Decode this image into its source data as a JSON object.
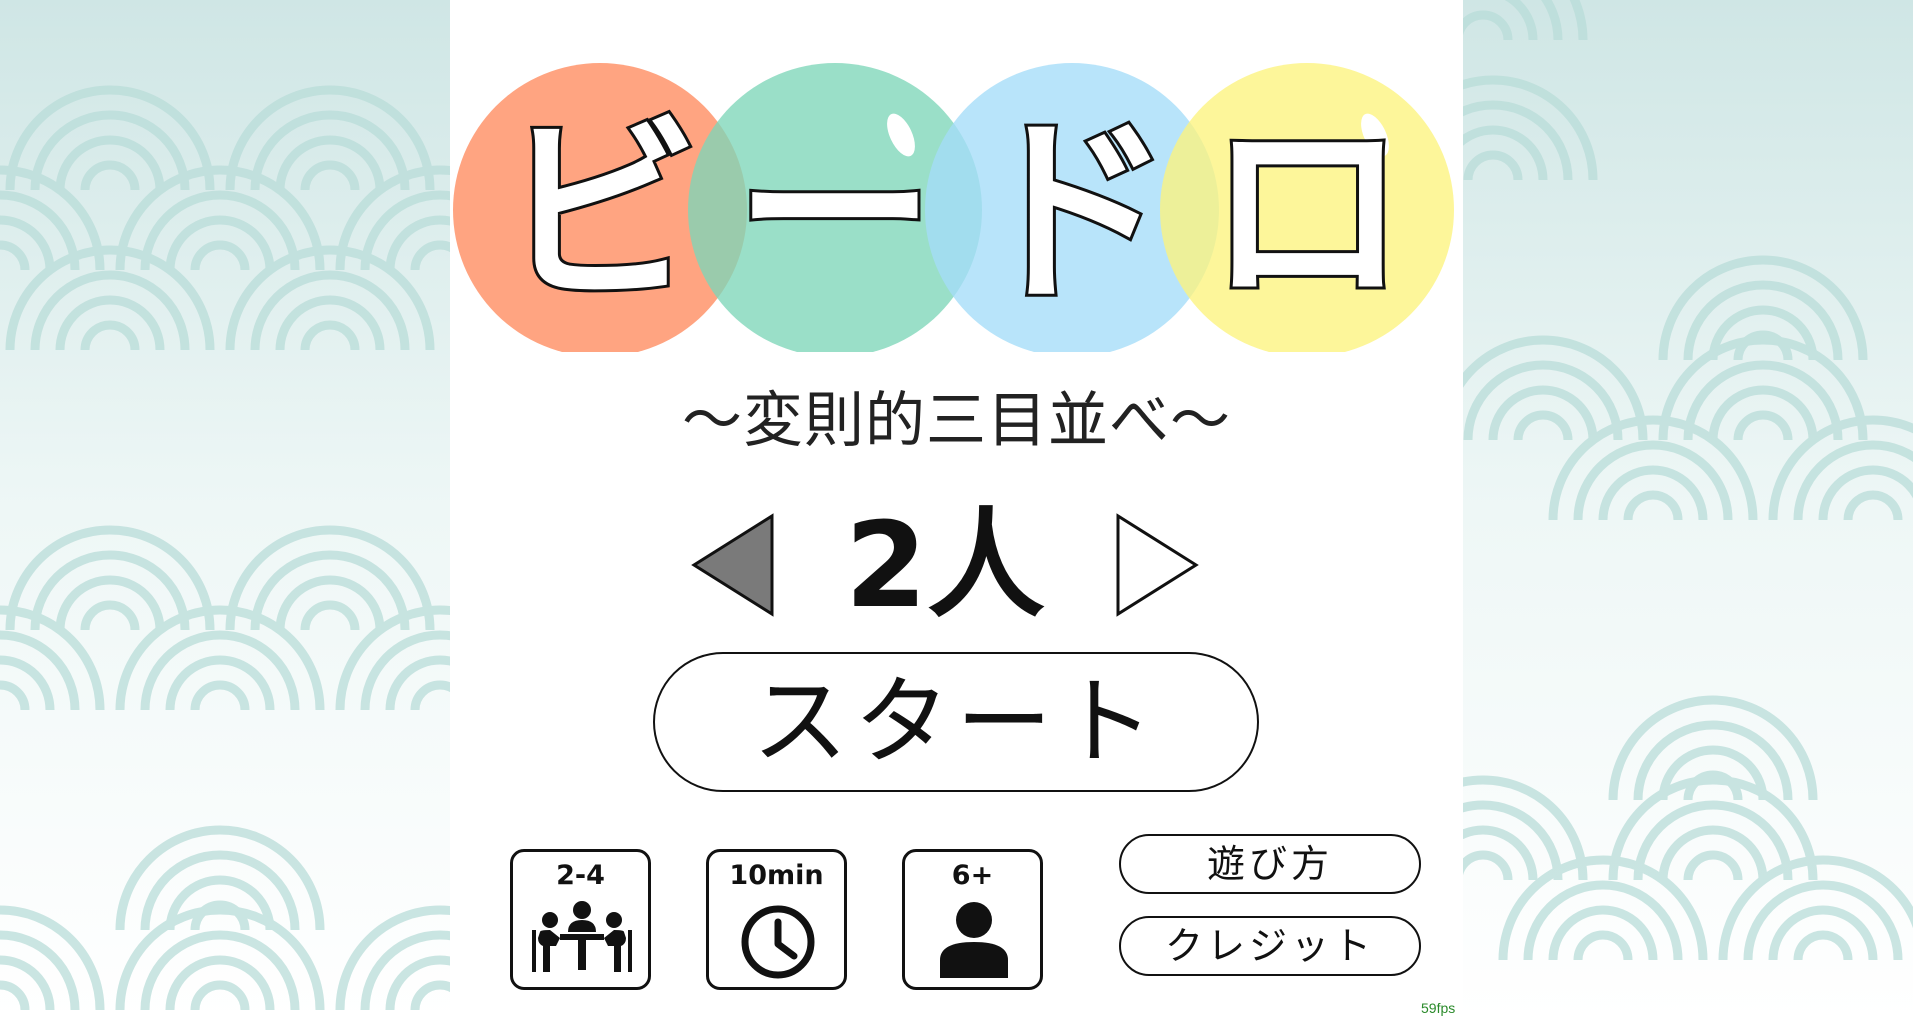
{
  "title": {
    "chars": [
      "ビ",
      "ー",
      "ド",
      "ロ"
    ],
    "circle_colors": [
      "#ff9f7a",
      "#7ed6b8",
      "#a4dcf8",
      "#fdf47e"
    ]
  },
  "subtitle": "〜変則的三目並べ〜",
  "player_select": {
    "count_label": "2人",
    "left_arrow_icon": "triangle-left-filled-icon",
    "right_arrow_icon": "triangle-right-outline-icon"
  },
  "start_button": {
    "label": "スタート"
  },
  "info_cards": {
    "players": {
      "label": "2-4",
      "icon": "meeting-table-icon"
    },
    "time": {
      "label": "10min",
      "icon": "clock-icon"
    },
    "age": {
      "label": "6+",
      "icon": "person-icon"
    }
  },
  "menu": {
    "howto_label": "遊び方",
    "credit_label": "クレジット"
  },
  "fps": "59fps",
  "colors": {
    "background_pattern": "#bfe0dd",
    "board": "#ffffff",
    "fps_text": "#2a8a2a"
  }
}
